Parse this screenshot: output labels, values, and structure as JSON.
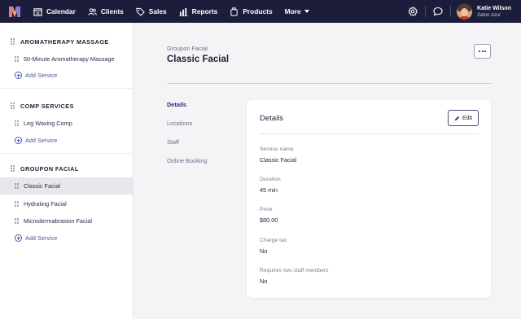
{
  "nav": {
    "items": [
      {
        "label": "Calendar",
        "icon": "calendar-icon"
      },
      {
        "label": "Clients",
        "icon": "users-icon"
      },
      {
        "label": "Sales",
        "icon": "tag-icon"
      },
      {
        "label": "Reports",
        "icon": "bar-chart-icon"
      },
      {
        "label": "Products",
        "icon": "box-icon"
      }
    ],
    "more_label": "More",
    "user_name": "Katie Wilson",
    "user_salon": "Salon Azul"
  },
  "sidebar": {
    "groups": [
      {
        "title": "AROMATHERAPY MASSAGE",
        "services": [
          "50-Minute Aromatherapy Massage"
        ],
        "add_label": "Add Service"
      },
      {
        "title": "COMP SERVICES",
        "services": [
          "Leg Waxing Comp"
        ],
        "add_label": "Add Service"
      },
      {
        "title": "GROUPON FACIAL",
        "services": [
          "Classic Facial",
          "Hydrating Facial",
          "Microdermabrasion Facial"
        ],
        "add_label": "Add Service"
      }
    ],
    "active_service": "Classic Facial"
  },
  "main": {
    "breadcrumb": "Groupon Facial",
    "title": "Classic Facial",
    "tabs": [
      "Details",
      "Locations",
      "Staff",
      "Online Booking"
    ],
    "active_tab": "Details"
  },
  "details": {
    "title": "Details",
    "edit_label": "Edit",
    "fields": [
      {
        "label": "Service name",
        "value": "Classic Facial"
      },
      {
        "label": "Duration",
        "value": "45 min"
      },
      {
        "label": "Price",
        "value": "$80.00"
      },
      {
        "label": "Charge tax",
        "value": "No"
      },
      {
        "label": "Requires two staff members",
        "value": "No"
      }
    ]
  },
  "colors": {
    "nav_bg": "#1c1d3b",
    "accent": "#4a57a8",
    "page_bg": "#f4f4f6"
  }
}
